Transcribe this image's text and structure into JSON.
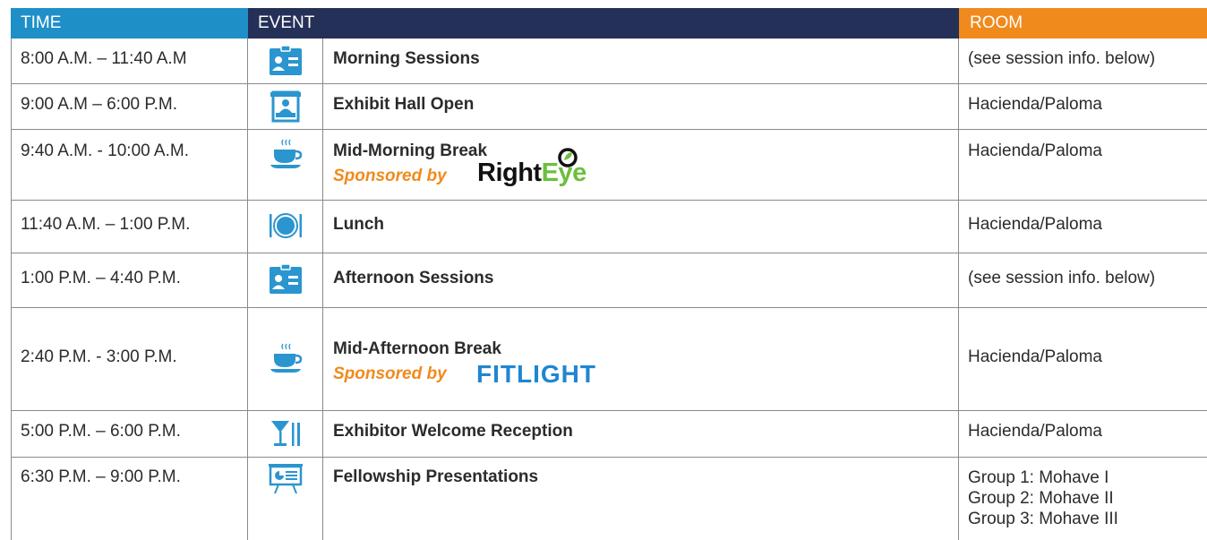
{
  "header": {
    "time": "TIME",
    "event": "EVENT",
    "room": "ROOM"
  },
  "colors": {
    "time_header": "#1f8fc8",
    "event_header": "#243057",
    "room_header": "#f08a1c",
    "icon": "#2b95cf",
    "sponsor_text": "#f08a1c",
    "brand_green": "#6cbf3c",
    "brand_blue": "#1f86d1"
  },
  "rows": [
    {
      "time": "8:00 A.M. – 11:40 A.M",
      "icon": "badge-icon",
      "event": "Morning Sessions",
      "room": [
        "(see session info. below)"
      ]
    },
    {
      "time": "9:00 A.M – 6:00 P.M.",
      "icon": "exhibit-booth-icon",
      "event": "Exhibit Hall Open",
      "room": [
        "Hacienda/Paloma"
      ]
    },
    {
      "time": "9:40 A.M. - 10:00 A.M.",
      "icon": "coffee-cup-icon",
      "event": "Mid-Morning Break",
      "sponsor": "Sponsored by",
      "logo": {
        "name": "righteye-logo",
        "part1": "Right",
        "part2": "Eye"
      },
      "room": [
        "Hacienda/Paloma"
      ]
    },
    {
      "time": "11:40 A.M. – 1:00 P.M.",
      "icon": "plate-cutlery-icon",
      "event": "Lunch",
      "room": [
        "Hacienda/Paloma"
      ]
    },
    {
      "time": "1:00 P.M. – 4:40 P.M.",
      "icon": "badge-icon",
      "event": "Afternoon Sessions",
      "room": [
        "(see session info. below)"
      ]
    },
    {
      "time": "2:40 P.M. - 3:00 P.M.",
      "icon": "coffee-cup-icon",
      "event": "Mid-Afternoon Break",
      "sponsor": "Sponsored by",
      "logo": {
        "name": "fitlight-logo",
        "part1": "FITLIGHT"
      },
      "room": [
        "Hacienda/Paloma"
      ]
    },
    {
      "time": "5:00 P.M. – 6:00 P.M.",
      "icon": "cocktail-icon",
      "event": "Exhibitor Welcome Reception",
      "room": [
        "Hacienda/Paloma"
      ]
    },
    {
      "time": "6:30 P.M. – 9:00 P.M.",
      "icon": "presentation-screen-icon",
      "event": "Fellowship Presentations",
      "room": [
        "Group 1: Mohave I",
        "Group 2: Mohave II",
        "Group 3: Mohave III"
      ]
    }
  ]
}
